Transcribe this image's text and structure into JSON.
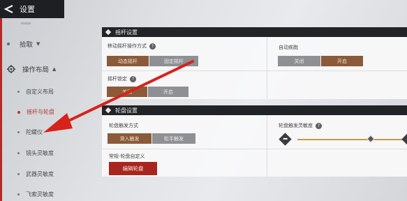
{
  "header": {
    "title": "设置"
  },
  "sidebar": {
    "groups": [
      {
        "label": "拾取",
        "chevron": "chevron-down"
      },
      {
        "label": "操作布局",
        "chevron": "chevron-up"
      }
    ],
    "items": [
      {
        "label": "自定义布局"
      },
      {
        "label": "摇杆与轮盘"
      },
      {
        "label": "陀螺仪"
      },
      {
        "label": "镜头灵敏度"
      },
      {
        "label": "武器灵敏度"
      },
      {
        "label": "飞索灵敏度"
      }
    ]
  },
  "joystick_panel": {
    "title": "摇杆设置",
    "move_mode": {
      "label": "移动摇杆操作方式",
      "options": [
        "动态摇杆",
        "固定摇杆"
      ],
      "selected": "动态摇杆"
    },
    "auto_run": {
      "label": "自动疾跑",
      "options": [
        "关闭",
        "开启"
      ],
      "selected": "开启"
    },
    "joystick_lock": {
      "label": "摇杆锁定",
      "options": [
        "关闭",
        "开启"
      ],
      "selected": "关闭"
    }
  },
  "wheel_panel": {
    "title": "轮盘设置",
    "trigger_mode": {
      "label": "轮盘触发方式",
      "options": [
        "滑入触发",
        "松手触发"
      ],
      "selected": "滑入触发"
    },
    "sensitivity": {
      "label": "轮盘触发灵敏度",
      "level": 0.7
    },
    "custom": {
      "label": "常规-轮盘自定义",
      "button": "编辑轮盘"
    }
  },
  "colors": {
    "accent_red": "#a8261e",
    "selected_brown": "#8b5a3a",
    "slider_gold": "#c89a44",
    "arrow_red": "#d6231c"
  },
  "icons": [
    "back-arrow-icon",
    "gear-icon",
    "help-icon",
    "minus-icon",
    "plus-icon"
  ]
}
